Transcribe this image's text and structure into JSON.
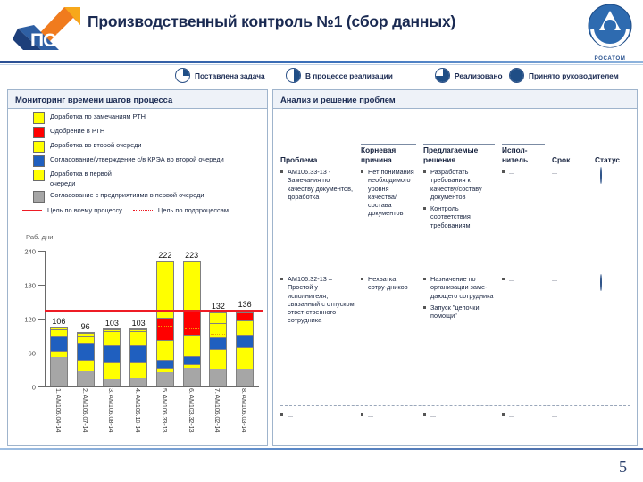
{
  "header": {
    "title": "Производственный контроль №1 (сбор данных)",
    "left_logo_name": "ПСР",
    "right_logo_word": "РОСАТОМ"
  },
  "status_legend": [
    {
      "label": "Поставлена задача",
      "icon": "pie-quarter-icon"
    },
    {
      "label": "В процессе реализации",
      "icon": "pie-half-icon"
    },
    {
      "label": "Реализовано",
      "icon": "pie-three-quarter-icon"
    },
    {
      "label": "Принято руководителем",
      "icon": "pie-full-icon"
    }
  ],
  "left_panel": {
    "title": "Мониторинг времени шагов процесса",
    "legend": [
      {
        "label": "Доработка по замечаниям РТН",
        "color": "#FFFF00"
      },
      {
        "label": "Одобрение в РТН",
        "color": "#FF0000"
      },
      {
        "label": "Доработка во второй очереди",
        "color": "#FFFF00"
      },
      {
        "label": "Согласование/утверждение с/в КРЭА во второй очереди",
        "color": "#1F5FBF"
      },
      {
        "label": "Доработка в первой\nочереди",
        "color": "#FFFF00"
      },
      {
        "label": "Согласование с предприятиями в первой очереди",
        "color": "#A6A6A6"
      }
    ],
    "target_legend": {
      "solid": "Цель по всему процессу",
      "dotted": "Цель по подпроцессам",
      "color": "#EE1C25"
    }
  },
  "chart_data": {
    "type": "bar",
    "subtype": "stacked",
    "title": "Мониторинг времени шагов процесса",
    "ylabel": "Раб. дни",
    "xlabel": "",
    "ylim": [
      0,
      240
    ],
    "yticks": [
      0,
      60,
      120,
      180,
      240
    ],
    "grid": false,
    "legend_position": "top",
    "categories": [
      "1. AM106.04-14",
      "2. AM106.07-14",
      "3. AM106.08-14",
      "4. AM106.10-14",
      "5. AM106.33-13",
      "6. AM103.32-13",
      "7. AM106.02-14",
      "8. AM106.03-14"
    ],
    "totals": [
      106,
      96,
      103,
      103,
      222,
      223,
      132,
      136
    ],
    "series": [
      {
        "name": "Согласование с предприятиями в первой очереди",
        "color": "#A6A6A6",
        "values": [
          52,
          26,
          12,
          14,
          24,
          32,
          30,
          30
        ]
      },
      {
        "name": "Доработка в первой очереди",
        "color": "#FFFF00",
        "values": [
          12,
          22,
          30,
          28,
          8,
          7,
          36,
          40
        ]
      },
      {
        "name": "Согласование/утверждение с/в КРЭА во второй очереди",
        "color": "#1F5FBF",
        "values": [
          28,
          30,
          32,
          32,
          14,
          14,
          22,
          22
        ]
      },
      {
        "name": "Доработка во второй очереди",
        "color": "#FFFF00",
        "values": [
          10,
          14,
          25,
          25,
          36,
          38,
          26,
          26
        ]
      },
      {
        "name": "Одобрение в РТН",
        "color": "#FF0000",
        "values": [
          0,
          0,
          0,
          0,
          40,
          42,
          0,
          14
        ]
      },
      {
        "name": "Доработка по замечаниям РТН",
        "color": "#FFFF00",
        "values": [
          4,
          4,
          4,
          4,
          100,
          90,
          18,
          4
        ]
      }
    ],
    "goal_line": {
      "label": "Цель по всему процессу",
      "value": 136,
      "color": "#EE1C25"
    },
    "subprocess_targets": {
      "label": "Цель по подпроцессам",
      "color": "#F0A000"
    }
  },
  "right_panel": {
    "title": "Анализ и решение проблем",
    "columns": [
      "Проблема",
      "Корневая причина",
      "Предлагаемые решения",
      "Испол-нитель",
      "Срок",
      "Статус"
    ],
    "rows": [
      {
        "problem": [
          "AM106.33-13 - Замечания по качеству документов, доработка"
        ],
        "root_cause": [
          "Нет понимания необходимого уровня качества/состава документов"
        ],
        "solutions": [
          "Разработать требования к качеству/составу документов",
          "Контроль соответствия требованиям"
        ],
        "owner": [
          "..."
        ],
        "due": "...",
        "status": "pie-three-quarter-icon"
      },
      {
        "problem": [
          "AM106.32-13 – Простой у исполнителя, связанный с отпуском ответ-ственного сотрудника"
        ],
        "root_cause": [
          "Нехватка сотру-дников"
        ],
        "solutions": [
          "Назначение по организации заме-дающего сотрудника",
          "Запуск \"цепочки помощи\""
        ],
        "owner": [
          "..."
        ],
        "due": "...",
        "status": "pie-half-icon"
      },
      {
        "problem": [
          "..."
        ],
        "root_cause": [
          "..."
        ],
        "solutions": [
          "..."
        ],
        "owner": [
          "..."
        ],
        "due": "...",
        "status": ""
      }
    ]
  },
  "footer": {
    "slide_number": "5"
  }
}
